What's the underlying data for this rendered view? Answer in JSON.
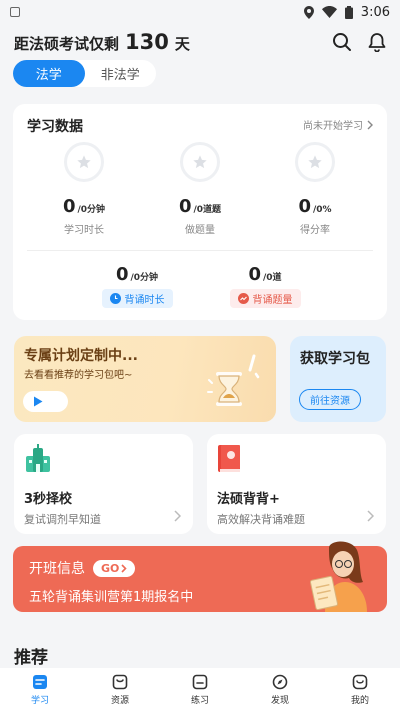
{
  "status": {
    "time": "3:06"
  },
  "header": {
    "countdown_prefix": "距法硕考试仅剩",
    "countdown_days": "130",
    "countdown_suffix": "天"
  },
  "switch": {
    "options": [
      "法学",
      "非法学"
    ],
    "selected": "法学"
  },
  "stats": {
    "title": "学习数据",
    "link": "尚未开始学习",
    "items": [
      {
        "value": "0",
        "unit": "/0分钟",
        "label": "学习时长"
      },
      {
        "value": "0",
        "unit": "/0道题",
        "label": "做题量"
      },
      {
        "value": "0",
        "unit": "/0%",
        "label": "得分率"
      }
    ],
    "recite": [
      {
        "value": "0",
        "unit": "/0分钟",
        "label": "背诵时长"
      },
      {
        "value": "0",
        "unit": "/0道",
        "label": "背诵题量"
      }
    ]
  },
  "plan": {
    "title": "专属计划定制中...",
    "subtitle": "去看看推荐的学习包吧~"
  },
  "package": {
    "title": "获取学习包",
    "button": "前往资源"
  },
  "features": [
    {
      "title": "3秒择校",
      "subtitle": "复试调剂早知道"
    },
    {
      "title": "法硕背背+",
      "subtitle": "高效解决背诵难题"
    }
  ],
  "banner": {
    "title": "开班信息",
    "go": "GO",
    "subtitle": "五轮背诵集训营第1期报名中"
  },
  "section": {
    "title": "推荐"
  },
  "tabs": [
    {
      "label": "学习",
      "icon": "study-icon",
      "active": true
    },
    {
      "label": "资源",
      "icon": "resource-icon",
      "active": false
    },
    {
      "label": "练习",
      "icon": "practice-icon",
      "active": false
    },
    {
      "label": "发现",
      "icon": "discover-icon",
      "active": false
    },
    {
      "label": "我的",
      "icon": "profile-icon",
      "active": false
    }
  ],
  "colors": {
    "primary": "#1b87f1",
    "banner": "#ee6a55",
    "plan_bg": "#fde6bd",
    "package_bg": "#ddeefd"
  }
}
